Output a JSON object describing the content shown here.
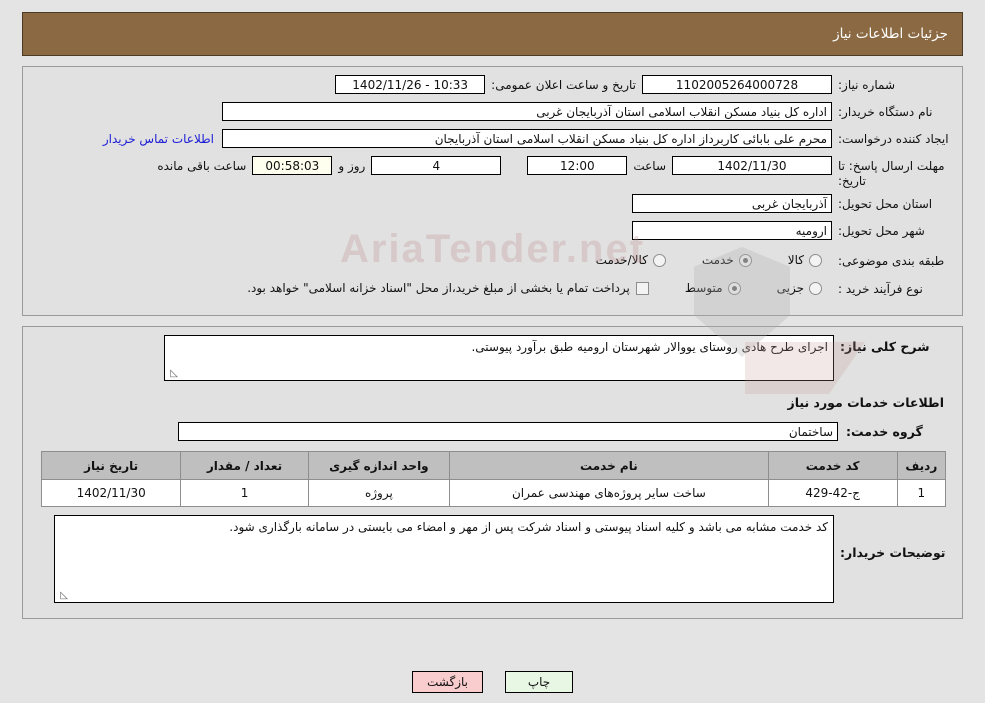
{
  "header": {
    "title": "جزئیات اطلاعات نیاز"
  },
  "form": {
    "need_number_label": "شماره نیاز:",
    "need_number_value": "1102005264000728",
    "announce_label": "تاریخ و ساعت اعلان عمومی:",
    "announce_value": "10:33 - 1402/11/26",
    "buyer_org_label": "نام دستگاه خریدار:",
    "buyer_org_value": "اداره کل بنیاد مسکن انقلاب اسلامی استان آذربایجان غربی",
    "creator_label": "ایجاد کننده درخواست:",
    "creator_value": "محرم علی بابائی کاربرداز اداره کل بنیاد مسکن انقلاب اسلامی استان آذربایجان",
    "contact_link": "اطلاعات تماس خریدار",
    "deadline_label": "مهلت ارسال پاسخ: تا تاریخ:",
    "deadline_date": "1402/11/30",
    "hour_label": "ساعت",
    "deadline_time": "12:00",
    "days_remaining": "4",
    "days_suffix": "روز و",
    "countdown": "00:58:03",
    "countdown_suffix": "ساعت باقی مانده",
    "province_label": "استان محل تحویل:",
    "province_value": "آذربایجان غربی",
    "city_label": "شهر محل تحویل:",
    "city_value": "ارومیه",
    "classification_label": "طبقه بندی موضوعی:",
    "classification_options": [
      {
        "label": "کالا",
        "checked": false
      },
      {
        "label": "خدمت",
        "checked": true
      },
      {
        "label": "کالا/خدمت",
        "checked": false
      }
    ],
    "process_label": "نوع فرآیند خرید :",
    "process_options": [
      {
        "label": "جزیی",
        "checked": false
      },
      {
        "label": "متوسط",
        "checked": true
      }
    ],
    "treasury_checkbox_text": "پرداخت تمام یا بخشی از مبلغ خرید،از محل \"اسناد خزانه اسلامی\" خواهد بود.",
    "treasury_checked": false
  },
  "detail": {
    "summary_label": "شرح کلی نیاز:",
    "summary_value": "اجرای طرح هادی روستای یووالار شهرستان ارومیه طبق برآورد پیوستی.",
    "services_heading": "اطلاعات خدمات مورد نیاز",
    "service_group_label": "گروه خدمت:",
    "service_group_value": "ساختمان",
    "buyer_notes_label": "توضیحات خریدار:",
    "buyer_notes_value": "کد خدمت مشابه می باشد و کلیه اسناد پیوستی و اسناد شرکت پس از مهر و امضاء می بایستی در سامانه بارگذاری شود."
  },
  "table": {
    "columns": [
      "ردیف",
      "کد خدمت",
      "نام خدمت",
      "واحد اندازه گیری",
      "تعداد / مقدار",
      "تاریخ نیاز"
    ],
    "rows": [
      {
        "radif": "1",
        "code": "ج-42-429",
        "name": "ساخت سایر پروژه‌های مهندسی عمران",
        "unit": "پروژه",
        "qty": "1",
        "date": "1402/11/30"
      }
    ]
  },
  "footer": {
    "print_label": "چاپ",
    "back_label": "بازگشت"
  },
  "watermark": {
    "text": "AriaTender.net"
  },
  "colors": {
    "header_bg": "#8b6a43",
    "page_bg": "#e4e4e4",
    "panel_bg": "#e1e1e1",
    "link": "#1b1bd6",
    "table_header_bg": "#bfbfbf",
    "print_btn_bg": "#e8f6e4",
    "back_btn_bg": "#f9cdcd",
    "countdown_bg": "#fffff0"
  }
}
